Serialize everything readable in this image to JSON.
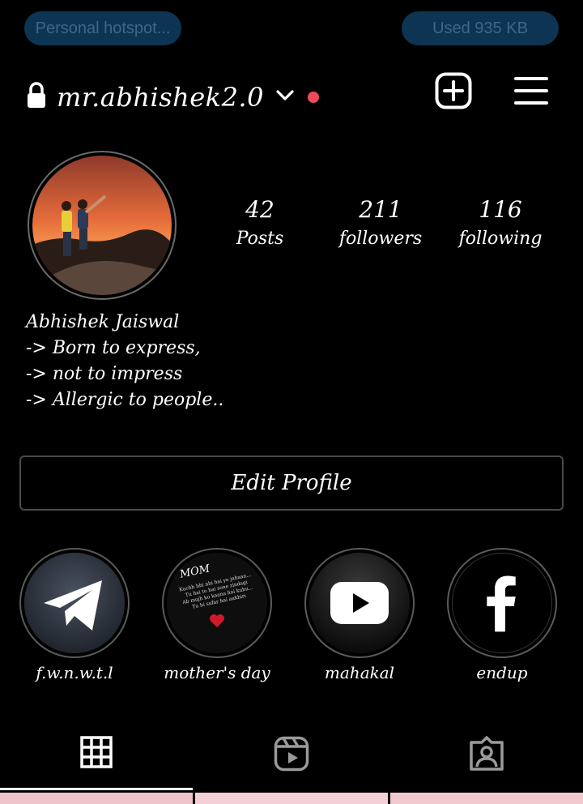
{
  "status_bar": {
    "hotspot_label": "Personal hotspot...",
    "data_used_label": "Used  935 KB"
  },
  "header": {
    "username": "mr.abhishek2.0",
    "lock_icon": "lock-icon",
    "dropdown_icon": "chevron-down-icon",
    "notification_color": "#ef4a5b",
    "new_post_icon": "plus-square-icon",
    "menu_icon": "hamburger-icon"
  },
  "stats": {
    "posts": {
      "value": "42",
      "label": "Posts"
    },
    "followers": {
      "value": "211",
      "label": "followers"
    },
    "following": {
      "value": "116",
      "label": "following"
    }
  },
  "bio": {
    "name": "Abhishek Jaiswal",
    "lines": [
      "-> Born to express,",
      "-> not to impress",
      "-> Allergic to people.."
    ]
  },
  "edit_profile_label": "Edit Profile",
  "highlights": [
    {
      "label": "f.w.n.w.t.l",
      "icon": "telegram-icon"
    },
    {
      "label": "mother's day",
      "icon": "mom-quote-image",
      "overlay": "MOM",
      "text_lines": [
        "Kuchh bhi nhi hai ye jahaan...",
        "Tu hai to hai sone zindagi",
        "Ab mujh ko kaana hai kuhu...",
        "Tu hi sufar hai aakhiri"
      ]
    },
    {
      "label": "mahakal",
      "icon": "youtube-icon"
    },
    {
      "label": "endup",
      "icon": "facebook-icon"
    }
  ],
  "tabs": [
    {
      "name": "grid",
      "icon": "grid-icon",
      "active": true
    },
    {
      "name": "reels",
      "icon": "reels-icon",
      "active": false
    },
    {
      "name": "tagged",
      "icon": "tagged-icon",
      "active": false
    }
  ]
}
